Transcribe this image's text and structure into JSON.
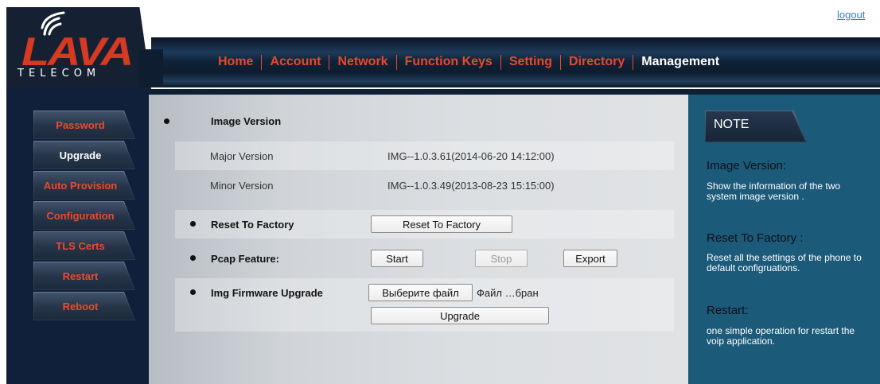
{
  "logo": {
    "word": "LAVA",
    "subtitle": "TELECOM"
  },
  "header": {
    "logout_label": "logout"
  },
  "nav": {
    "items": [
      {
        "label": "Home"
      },
      {
        "label": "Account"
      },
      {
        "label": "Network"
      },
      {
        "label": "Function Keys"
      },
      {
        "label": "Setting"
      },
      {
        "label": "Directory"
      },
      {
        "label": "Management"
      }
    ],
    "active": "Management"
  },
  "sidebar": {
    "items": [
      {
        "label": "Password"
      },
      {
        "label": "Upgrade"
      },
      {
        "label": "Auto Provision"
      },
      {
        "label": "Configuration"
      },
      {
        "label": "TLS Certs"
      },
      {
        "label": "Restart"
      },
      {
        "label": "Reboot"
      }
    ],
    "active": "Upgrade"
  },
  "main": {
    "image_version": {
      "title": "Image Version",
      "major_label": "Major Version",
      "major_value": "IMG--1.0.3.61(2014-06-20 14:12:00)",
      "minor_label": "Minor Version",
      "minor_value": "IMG--1.0.3.49(2013-08-23 15:15:00)"
    },
    "reset": {
      "title": "Reset To Factory",
      "button_label": "Reset To Factory"
    },
    "pcap": {
      "title": "Pcap Feature:",
      "start_label": "Start",
      "stop_label": "Stop",
      "export_label": "Export"
    },
    "firmware": {
      "title": "Img Firmware Upgrade",
      "choose_file_label": "Выберите файл",
      "file_status": "Файл …бран",
      "upgrade_label": "Upgrade"
    }
  },
  "note": {
    "title": "NOTE",
    "sections": [
      {
        "heading": "Image Version:",
        "lines": [
          "Show the information of the two",
          "system image version ."
        ]
      },
      {
        "heading": "Reset To Factory :",
        "lines": [
          "Reset all the settings of the phone to",
          "default configruations."
        ]
      },
      {
        "heading": "Restart:",
        "lines": [
          "one simple operation for restart the",
          "voip application."
        ]
      }
    ]
  },
  "colors": {
    "nav_accent": "#e8482a",
    "sidebar_bg": "#10203a",
    "note_bg": "#1c5a7a",
    "link": "#3a7ac8"
  }
}
